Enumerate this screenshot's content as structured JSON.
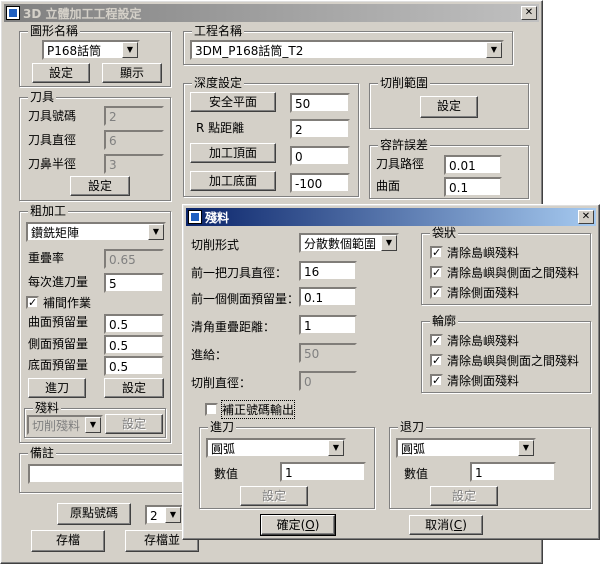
{
  "main_window": {
    "title": "3D 立體加工工程設定",
    "close_glyph": "✕",
    "shape_group": {
      "legend": "圖形名稱",
      "shape_select": "P168話筒",
      "setup_button": "設定",
      "display_button": "顯示"
    },
    "project_group": {
      "legend": "工程名稱",
      "project_select": "3DM_P168話筒_T2"
    },
    "tool_group": {
      "legend": "刀具",
      "tool_number_label": "刀具號碼",
      "tool_number_value": "2",
      "tool_diameter_label": "刀具直徑",
      "tool_diameter_value": "6",
      "tool_radius_label": "刀鼻半徑",
      "tool_radius_value": "3",
      "setup_button": "設定"
    },
    "depth_group": {
      "legend": "深度設定",
      "safe_plane_button": "安全平面",
      "safe_plane_value": "50",
      "r_distance_label": "R 點距離",
      "r_distance_value": "2",
      "top_button": "加工頂面",
      "top_value": "0",
      "bottom_button": "加工底面",
      "bottom_value": "-100"
    },
    "cut_range_group": {
      "legend": "切削範圍",
      "setup_button": "設定"
    },
    "tolerance_group": {
      "legend": "容許誤差",
      "tool_path_label": "刀具路徑",
      "tool_path_value": "0.01",
      "surface_label": "曲面",
      "surface_value": "0.1"
    },
    "rough_group": {
      "legend": "粗加工",
      "method_select": "鑽銑矩陣",
      "overlap_label": "重疊率",
      "overlap_value": "0.65",
      "step_down_label": "每次進刀量",
      "step_down_value": "5",
      "supplement_label": "補間作業",
      "supplement_checked": true,
      "surface_allowance_label": "曲面預留量",
      "surface_allowance_value": "0.5",
      "side_allowance_label": "側面預留量",
      "side_allowance_value": "0.5",
      "bottom_allowance_label": "底面預留量",
      "bottom_allowance_value": "0.5",
      "feed_button": "進刀",
      "setup_button": "設定",
      "residual_group": {
        "legend": "殘料",
        "mode_select": "切削殘料",
        "setup_button": "設定"
      }
    },
    "remarks_group": {
      "legend": "備註",
      "value": ""
    },
    "origin_button": "原點號碼",
    "origin_select": "2",
    "save_button": "存檔",
    "save_and_button": "存檔並"
  },
  "residual_dialog": {
    "title": "殘料",
    "close_glyph": "✕",
    "cut_form_label": "切削形式",
    "cut_form_select": "分散數個範圍",
    "prev_tool_diameter_label": "前一把刀具直徑：",
    "prev_tool_diameter_value": "16",
    "prev_side_allowance_label": "前一個側面預留量：",
    "prev_side_allowance_value": "0.1",
    "corner_overlap_label": "清角重疊距離：",
    "corner_overlap_value": "1",
    "feed_label": "進給：",
    "feed_value": "50",
    "cut_diameter_label": "切削直徑：",
    "cut_diameter_value": "0",
    "pocket_group": {
      "legend": "袋狀",
      "options": [
        {
          "label": "清除島嶼殘料",
          "checked": true
        },
        {
          "label": "清除島嶼與側面之間殘料",
          "checked": true
        },
        {
          "label": "清除側面殘料",
          "checked": true
        }
      ]
    },
    "contour_group": {
      "legend": "輪廓",
      "options": [
        {
          "label": "清除島嶼殘料",
          "checked": true
        },
        {
          "label": "清除島嶼與側面之間殘料",
          "checked": true
        },
        {
          "label": "清除側面殘料",
          "checked": true
        }
      ]
    },
    "compensation_label": "補正號碼輸出",
    "compensation_checked": false,
    "approach_group": {
      "legend": "進刀",
      "type_select": "圓弧",
      "value_label": "數值",
      "value": "1",
      "setup_button": "設定"
    },
    "retract_group": {
      "legend": "退刀",
      "type_select": "圓弧",
      "value_label": "數值",
      "value": "1",
      "setup_button": "設定"
    },
    "ok_button": "確定(O)",
    "ok_button_base": "確定(",
    "ok_button_key": "O",
    "ok_button_end": ")",
    "cancel_button_base": "取消(",
    "cancel_button_key": "C",
    "cancel_button_end": ")"
  }
}
